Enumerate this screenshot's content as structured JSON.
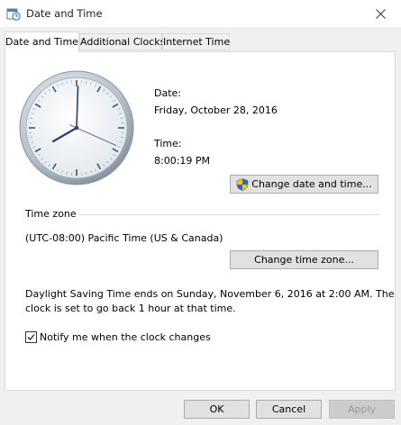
{
  "window": {
    "title": "Date and Time",
    "close_glyph": "✕"
  },
  "tabs": [
    {
      "label": "Date and Time",
      "active": true
    },
    {
      "label": "Additional Clocks",
      "active": false
    },
    {
      "label": "Internet Time",
      "active": false
    }
  ],
  "clock": {
    "time_shown": "8:00:19 PM",
    "hour": 8,
    "minute": 0,
    "second": 19
  },
  "date_section": {
    "date_label": "Date:",
    "date_value": "Friday, October 28, 2016",
    "time_label": "Time:",
    "time_value": "8:00:19 PM",
    "change_button": "Change date and time..."
  },
  "timezone_section": {
    "heading": "Time zone",
    "value": "(UTC-08:00) Pacific Time (US & Canada)",
    "change_button": "Change time zone..."
  },
  "dst_message": {
    "line1": "Daylight Saving Time ends on Sunday, November 6, 2016 at 2:00 AM. The",
    "line2": "clock is set to go back 1 hour at that time."
  },
  "notify": {
    "label": "Notify me when the clock changes",
    "checked": true
  },
  "footer": {
    "ok": "OK",
    "cancel": "Cancel",
    "apply": "Apply"
  },
  "colors": {
    "accent": "#0078d7",
    "panel": "#ffffff",
    "window_bg": "#f0f0f0",
    "shield_blue": "#2a67c8",
    "shield_yellow": "#f0c419"
  },
  "icons": [
    "date-time-app-icon",
    "close-icon",
    "uac-shield-icon",
    "checkmark-icon"
  ]
}
